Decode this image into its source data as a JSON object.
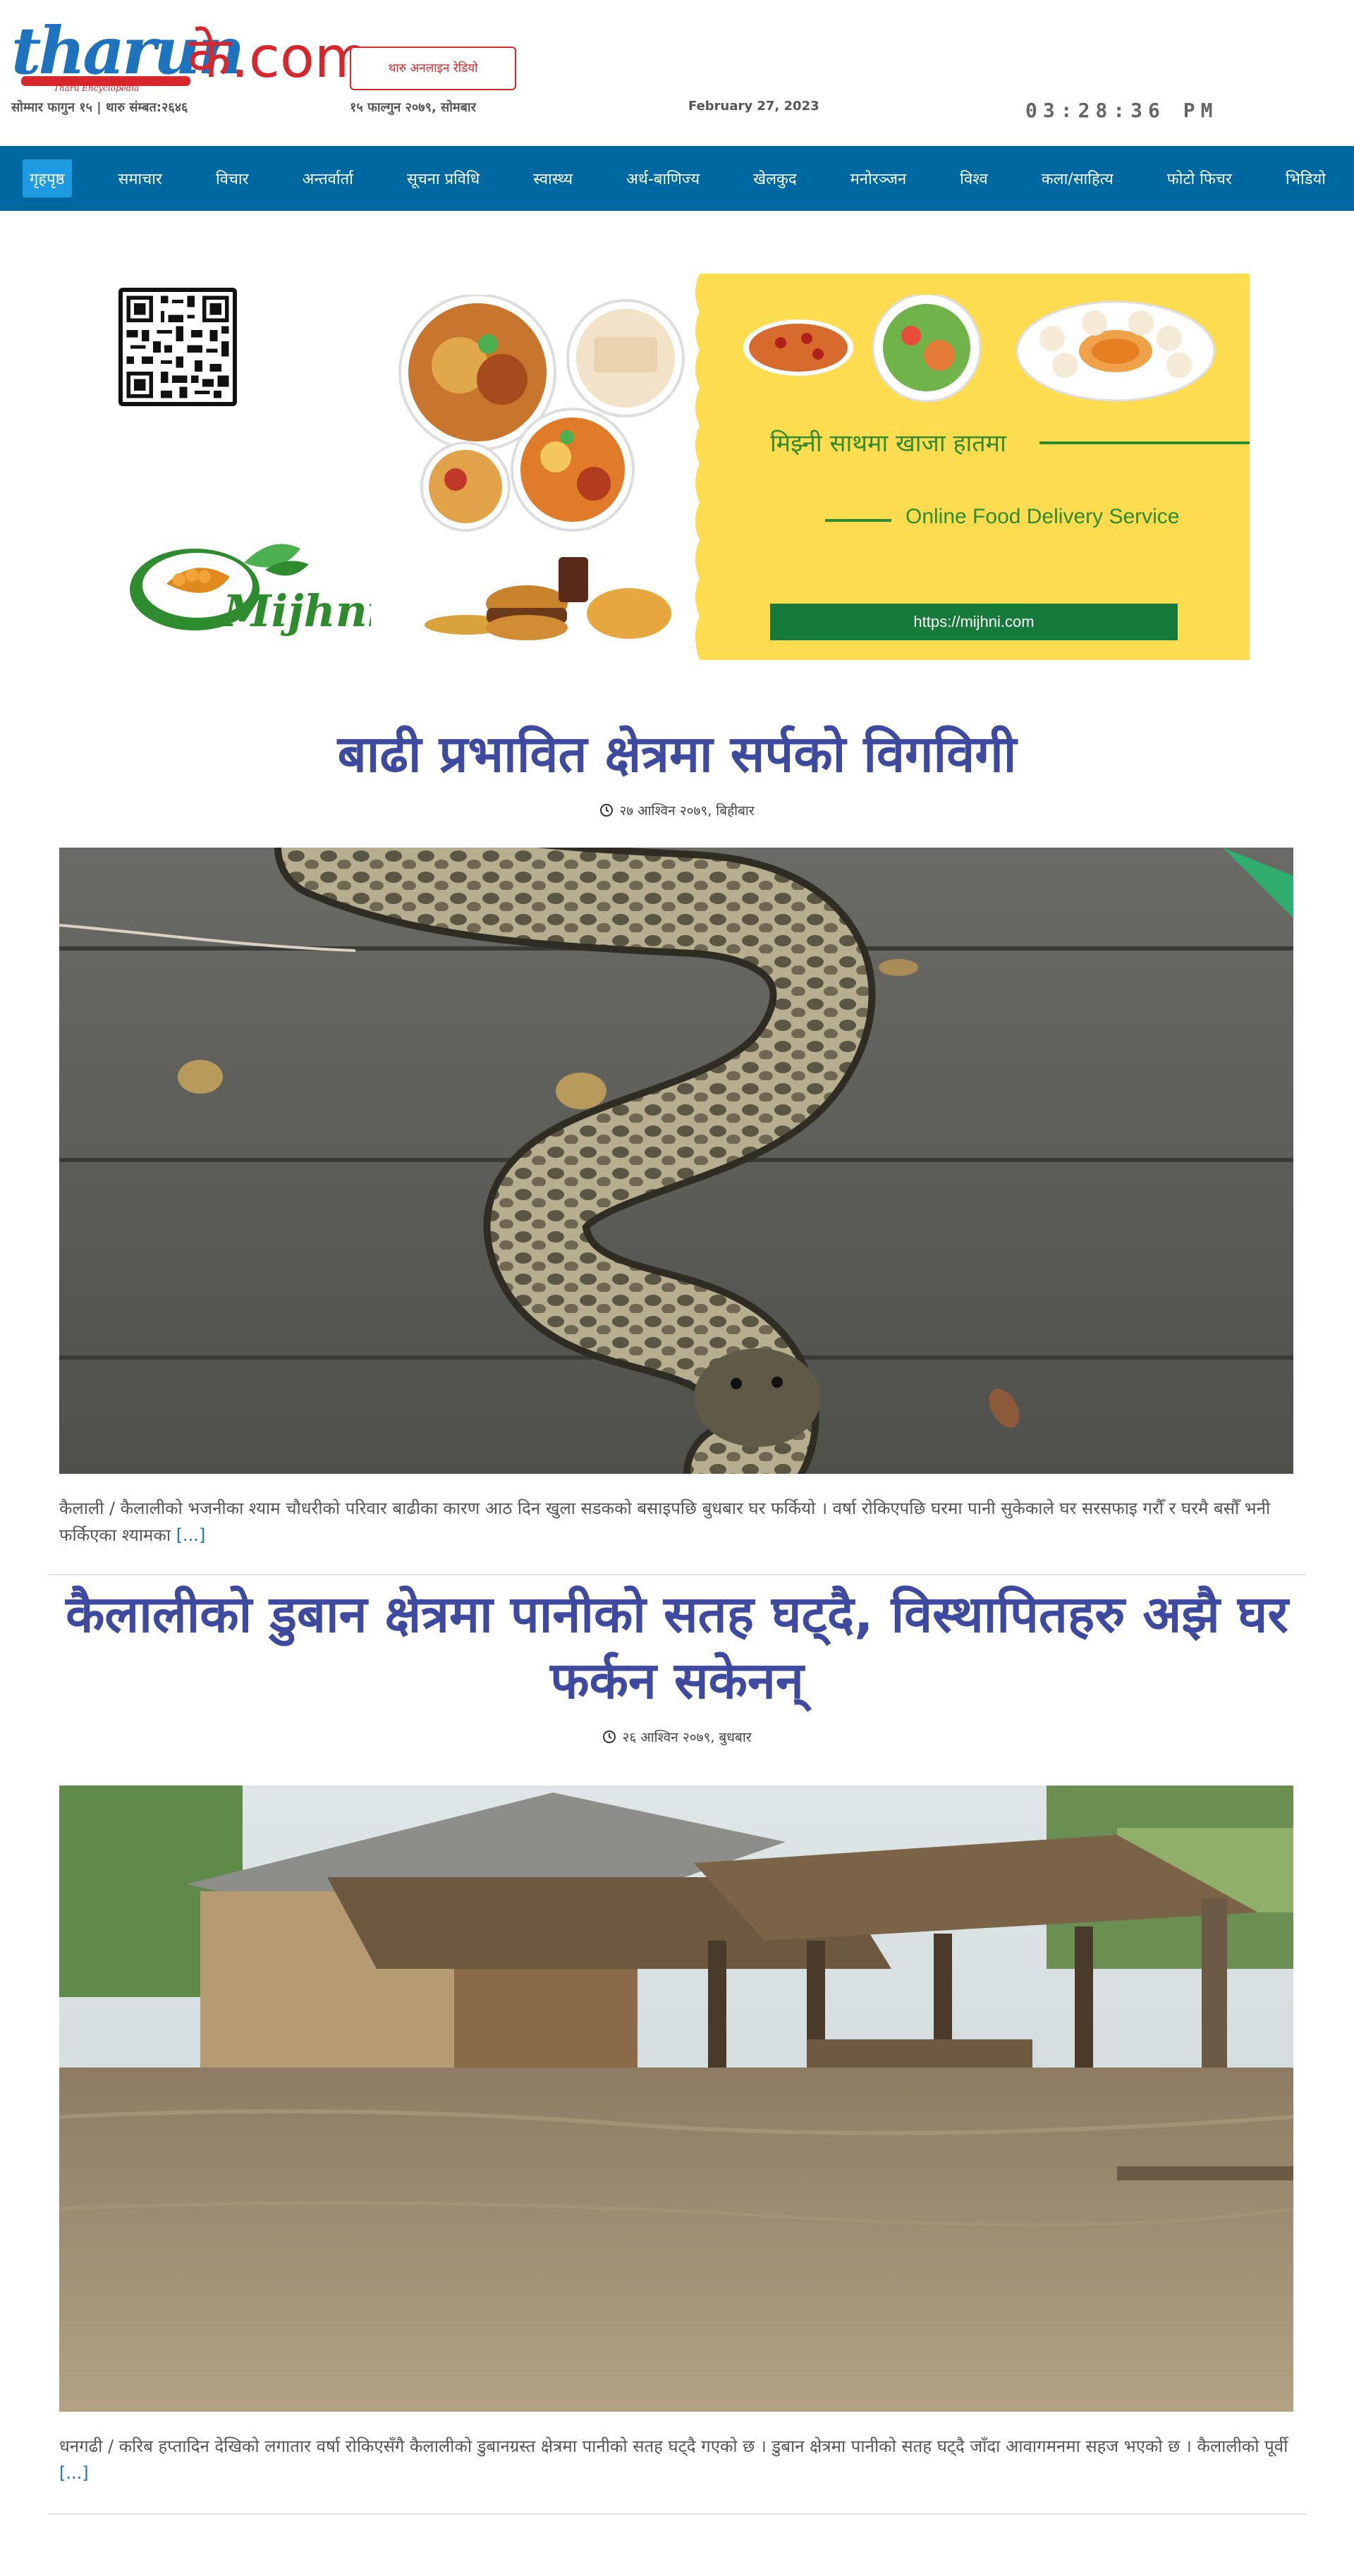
{
  "header": {
    "logo": {
      "name": "tharun",
      "suffix": "के.com",
      "tagline": "Tharu Encyclopedia"
    },
    "radio_label": "थारु अनलाइन रेडियो",
    "date_tharu": "सोम्मार फागुन १५ | थारु संम्बत:२६४६",
    "date_nepali": "१५ फाल्गुन २०७९, सोमबार",
    "date_english": "February 27, 2023",
    "clock": "03:28:36 PM"
  },
  "nav": {
    "items": [
      "गृहपृष्ठ",
      "समाचार",
      "विचार",
      "अन्तर्वार्ता",
      "सूचना प्रविधि",
      "स्वास्थ्य",
      "अर्थ-बाणिज्य",
      "खेलकुद",
      "मनोरञ्जन",
      "विश्व",
      "कला/साहित्य",
      "फोटो फिचर",
      "भिडियो"
    ],
    "active_index": 0,
    "background": "#0068a0",
    "active_background": "#1e9ae0"
  },
  "ad": {
    "brand": "Mijhni",
    "headline_ne": "मिझ्नी साथमा खाजा हातमा",
    "headline_en": "Online Food Delivery Service",
    "url": "https://mijhni.com",
    "bg_color": "#fddc4f",
    "accent_color": "#2e8b2e",
    "qr_icon": "qr-code-icon"
  },
  "articles": [
    {
      "title": "बाढी प्रभावित क्षेत्रमा सर्पको विगविगी",
      "date": "२७ आश्विन २०७९, बिहीबार",
      "image_alt": "python snake on wooden floor",
      "excerpt": "कैलाली / कैलालीको भजनीका श्याम चौधरीको परिवार बाढीका कारण आठ दिन खुला सडकको बसाइपछि बुधबार घर फर्कियो । वर्षा रोकिएपछि घरमा पानी सुकेकाले घर सरसफाइ गरौँ र घरमै बसौँ भनी फर्किएका श्यामका",
      "read_more": "[...]"
    },
    {
      "title": "कैलालीको डुबान क्षेत्रमा पानीको सतह घट्दै, विस्थापितहरु अझै घर फर्कन सकेनन्",
      "date": "२६ आश्विन २०७९, बुधबार",
      "image_alt": "flooded village houses",
      "excerpt": "धनगढी / करिब हप्तादिन देखिको लगातार वर्षा रोकिएसँगै कैलालीको डुबानग्रस्त क्षेत्रमा पानीको सतह घट्दै गएको छ । डुबान क्षेत्रमा पानीको सतह घट्दै जाँदा आवागमनमा सहज भएको छ । कैलालीको पूर्वी",
      "read_more": "[...]"
    }
  ]
}
